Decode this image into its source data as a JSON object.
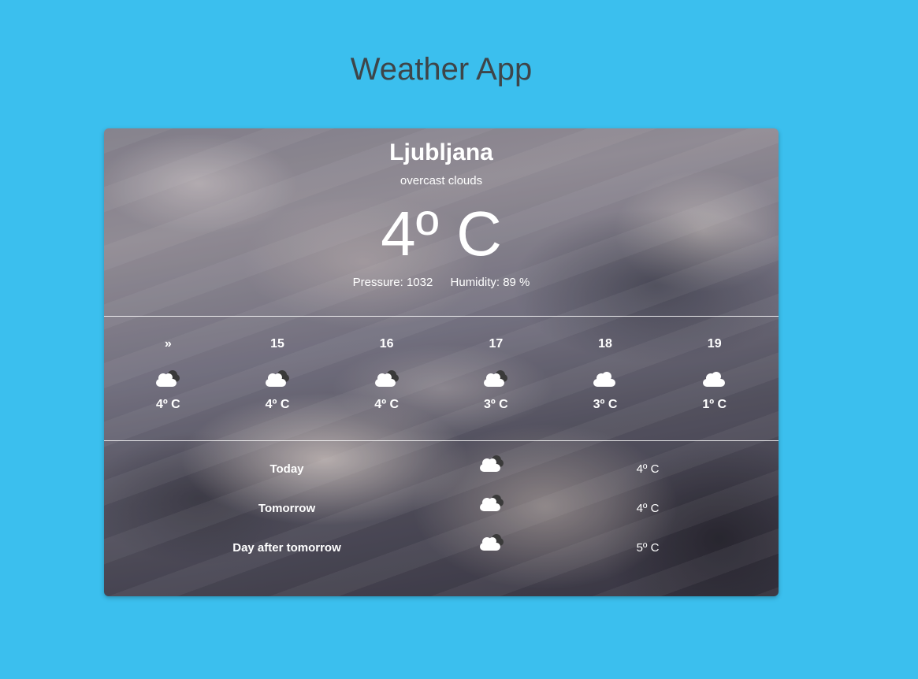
{
  "app": {
    "title": "Weather App"
  },
  "current": {
    "city": "Ljubljana",
    "description": "overcast clouds",
    "temperature": "4º C",
    "pressure": "Pressure: 1032",
    "humidity": "Humidity: 89 %"
  },
  "hourly": [
    {
      "label": "»",
      "icon": "broken-clouds-icon",
      "temp": "4º C"
    },
    {
      "label": "15",
      "icon": "broken-clouds-icon",
      "temp": "4º C"
    },
    {
      "label": "16",
      "icon": "broken-clouds-icon",
      "temp": "4º C"
    },
    {
      "label": "17",
      "icon": "broken-clouds-icon",
      "temp": "3º C"
    },
    {
      "label": "18",
      "icon": "cloud-icon",
      "temp": "3º C"
    },
    {
      "label": "19",
      "icon": "cloud-icon",
      "temp": "1º C"
    }
  ],
  "daily": [
    {
      "label": "Today",
      "icon": "broken-clouds-icon",
      "temp": "4º C"
    },
    {
      "label": "Tomorrow",
      "icon": "broken-clouds-icon",
      "temp": "4º C"
    },
    {
      "label": "Day after tomorrow",
      "icon": "broken-clouds-icon",
      "temp": "5º C"
    }
  ],
  "colors": {
    "background": "#3bbfee",
    "title": "#3e4549",
    "text": "#ffffff"
  }
}
